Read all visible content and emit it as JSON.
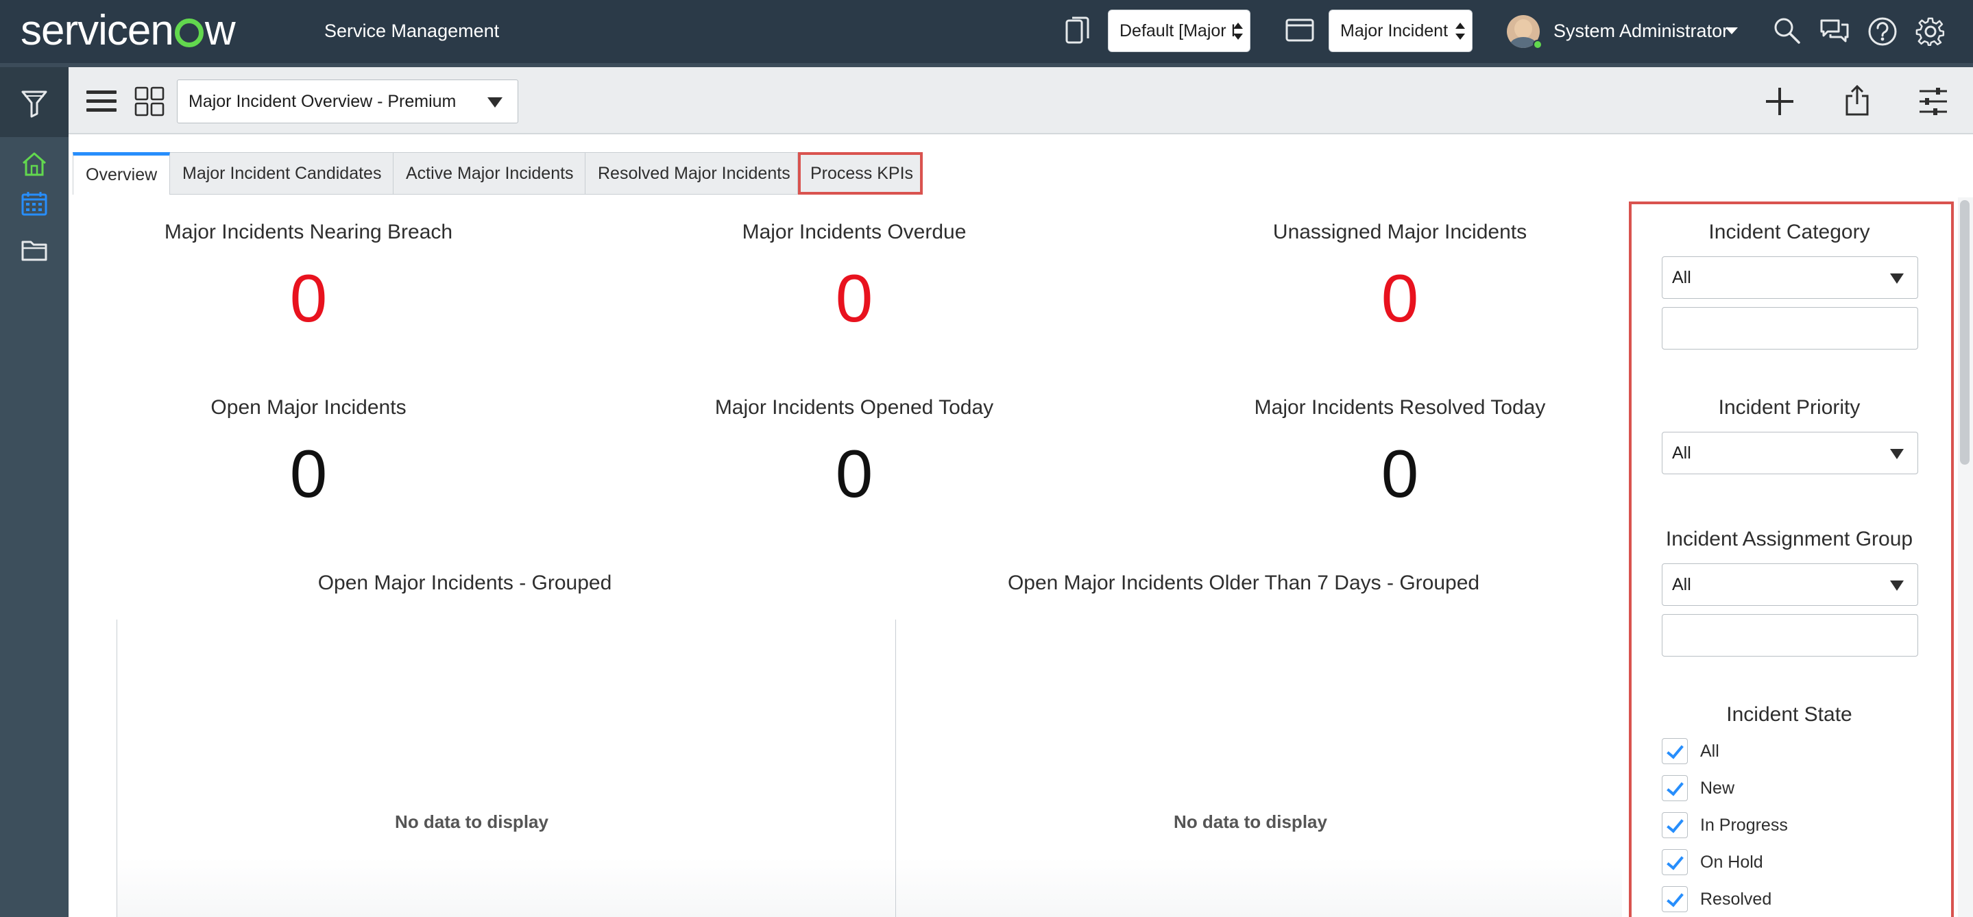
{
  "banner": {
    "logo_service": "service",
    "logo_n": "n",
    "logo_w": "w",
    "app_title": "Service Management",
    "update_set": "Default [Major I",
    "application_scope": "Major Incident",
    "user_name": "System Administrator"
  },
  "toolbar": {
    "dashboard": "Major Incident Overview - Premium"
  },
  "tabs": [
    {
      "label": "Overview"
    },
    {
      "label": "Major Incident Candidates"
    },
    {
      "label": "Active Major Incidents"
    },
    {
      "label": "Resolved Major Incidents"
    },
    {
      "label": "Process KPIs"
    }
  ],
  "widgets": [
    {
      "title": "Major Incidents Nearing Breach",
      "value": "0",
      "color": "#e8121e"
    },
    {
      "title": "Major Incidents Overdue",
      "value": "0",
      "color": "#e8121e"
    },
    {
      "title": "Unassigned Major Incidents",
      "value": "0",
      "color": "#e8121e"
    },
    {
      "title": "Open Major Incidents",
      "value": "0",
      "color": "#111111"
    },
    {
      "title": "Major Incidents Opened Today",
      "value": "0",
      "color": "#111111"
    },
    {
      "title": "Major Incidents Resolved Today",
      "value": "0",
      "color": "#111111"
    }
  ],
  "charts": [
    {
      "title": "Open Major Incidents - Grouped",
      "empty_text": "No data to display"
    },
    {
      "title": "Open Major Incidents Older Than 7 Days - Grouped",
      "empty_text": "No data to display"
    }
  ],
  "filters": {
    "category": {
      "title": "Incident Category",
      "selected": "All"
    },
    "priority": {
      "title": "Incident Priority",
      "selected": "All"
    },
    "assignment_group": {
      "title": "Incident Assignment Group",
      "selected": "All"
    },
    "state": {
      "title": "Incident State",
      "options": [
        {
          "label": "All",
          "checked": true
        },
        {
          "label": "New",
          "checked": true
        },
        {
          "label": "In Progress",
          "checked": true
        },
        {
          "label": "On Hold",
          "checked": true
        },
        {
          "label": "Resolved",
          "checked": true
        }
      ]
    }
  },
  "colors": {
    "banner": "#2b3a48",
    "accent": "#278efc",
    "highlight": "#d9534f",
    "alert_value": "#e8121e"
  }
}
